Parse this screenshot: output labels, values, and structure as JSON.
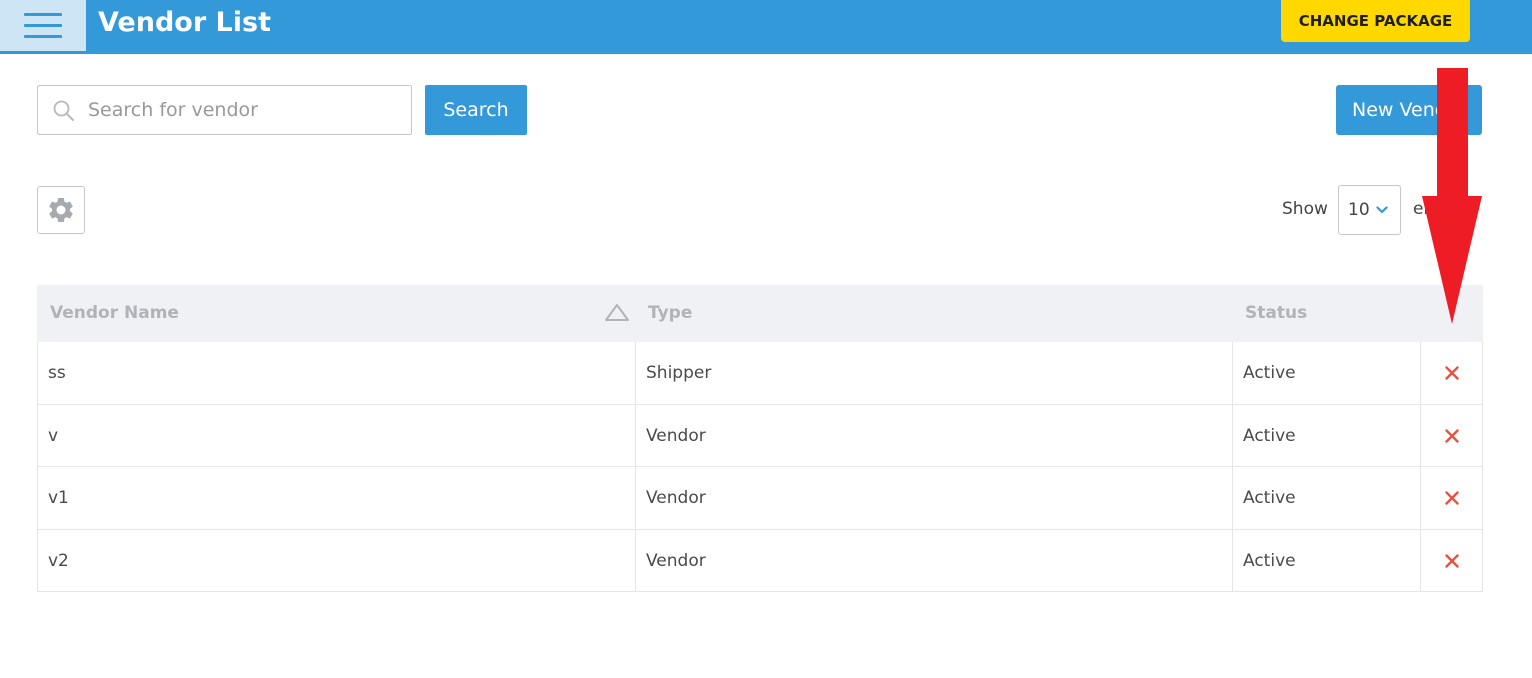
{
  "header": {
    "title": "Vendor List",
    "change_package_label": "CHANGE PACKAGE"
  },
  "toolbar": {
    "search_placeholder": "Search for vendor",
    "search_value": "",
    "search_label": "Search",
    "new_vendor_label": "New Vendor"
  },
  "listing": {
    "show_label": "Show",
    "page_size": "10",
    "entries_label": "entries"
  },
  "table": {
    "columns": [
      "Vendor Name",
      "Type",
      "Status",
      ""
    ],
    "rows": [
      {
        "name": "ss",
        "type": "Shipper",
        "status": "Active"
      },
      {
        "name": "v",
        "type": "Vendor",
        "status": "Active"
      },
      {
        "name": "v1",
        "type": "Vendor",
        "status": "Active"
      },
      {
        "name": "v2",
        "type": "Vendor",
        "status": "Active"
      }
    ]
  },
  "colors": {
    "primary": "#3399d9",
    "accent_yellow": "#ffd800",
    "delete_red": "#e8533f",
    "annotation_red": "#ee1c24"
  },
  "icons": {
    "menu": "hamburger-icon",
    "search": "magnifier-icon",
    "settings": "gear-icon",
    "sort": "triangle-up-icon",
    "select": "chevron-down-icon",
    "delete": "close-x-icon",
    "annotation": "red-arrow-down-icon"
  }
}
